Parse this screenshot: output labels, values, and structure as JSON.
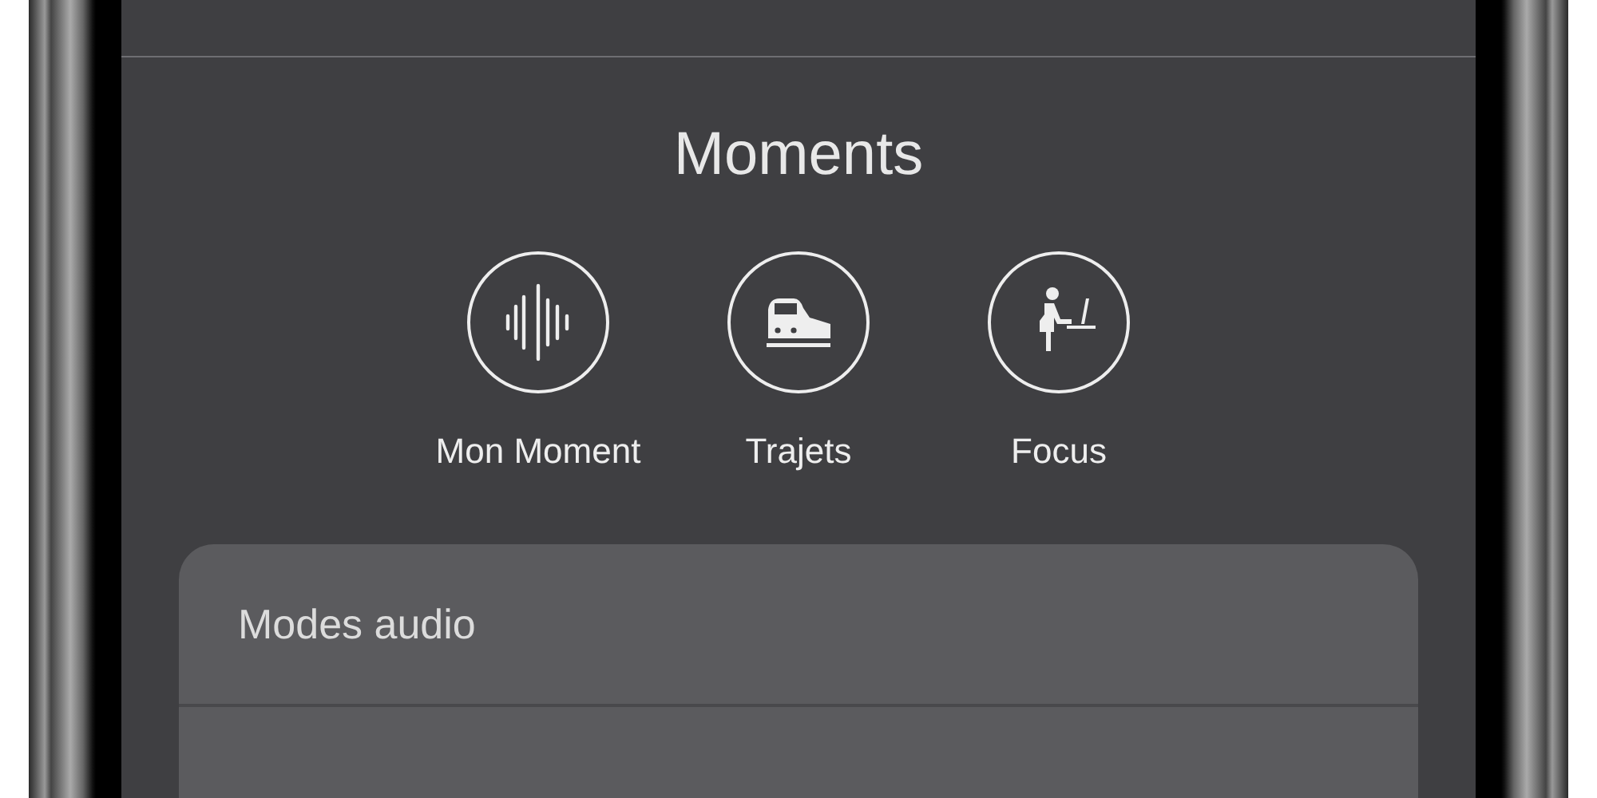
{
  "title": "Moments",
  "moments": [
    {
      "kind": "sound",
      "label": "Mon Moment"
    },
    {
      "kind": "train",
      "label": "Trajets"
    },
    {
      "kind": "desk",
      "label": "Focus"
    }
  ],
  "menu": [
    {
      "label": "Modes audio"
    }
  ]
}
